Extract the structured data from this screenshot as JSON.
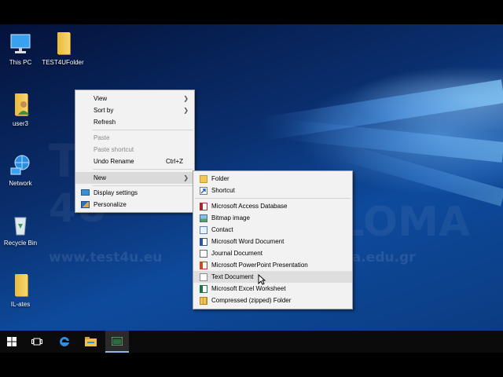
{
  "desktop_icons": [
    {
      "label": "This PC",
      "icon": "computer-icon"
    },
    {
      "label": "TEST4UFolder",
      "icon": "folder-icon"
    },
    {
      "label": "user3",
      "icon": "user-folder-icon"
    },
    {
      "label": "Network",
      "icon": "network-icon"
    },
    {
      "label": "Recycle Bin",
      "icon": "recycle-bin-icon"
    },
    {
      "label": "IL-ates",
      "icon": "folder-icon"
    }
  ],
  "watermark": {
    "brand_left": "TEST",
    "brand_left2": "4U",
    "brand_right": "DIPLOMA",
    "url_left": "www.test4u.eu",
    "url_right": "www.diploma.edu.gr"
  },
  "context_menu": {
    "items": [
      {
        "label": "View",
        "submenu": true
      },
      {
        "label": "Sort by",
        "submenu": true
      },
      {
        "label": "Refresh"
      },
      {
        "label": "Paste",
        "disabled": true
      },
      {
        "label": "Paste shortcut",
        "disabled": true
      },
      {
        "label": "Undo Rename",
        "shortcut": "Ctrl+Z"
      },
      {
        "label": "New",
        "submenu": true,
        "highlighted": true
      },
      {
        "label": "Display settings",
        "icon": "display-icon"
      },
      {
        "label": "Personalize",
        "icon": "personalize-icon"
      }
    ]
  },
  "new_submenu": {
    "items": [
      {
        "label": "Folder",
        "icon": "folder-icon"
      },
      {
        "label": "Shortcut",
        "icon": "shortcut-icon"
      },
      {
        "label": "Microsoft Access Database",
        "icon": "access-icon"
      },
      {
        "label": "Bitmap image",
        "icon": "bitmap-icon"
      },
      {
        "label": "Contact",
        "icon": "contact-icon"
      },
      {
        "label": "Microsoft Word Document",
        "icon": "word-icon"
      },
      {
        "label": "Journal Document",
        "icon": "journal-icon"
      },
      {
        "label": "Microsoft PowerPoint Presentation",
        "icon": "powerpoint-icon"
      },
      {
        "label": "Text Document",
        "icon": "text-document-icon",
        "highlighted": true
      },
      {
        "label": "Microsoft Excel Worksheet",
        "icon": "excel-icon"
      },
      {
        "label": "Compressed (zipped) Folder",
        "icon": "zip-folder-icon"
      }
    ]
  },
  "taskbar": {
    "buttons": [
      {
        "icon": "windows-start-icon"
      },
      {
        "icon": "task-view-icon"
      },
      {
        "icon": "edge-icon"
      },
      {
        "icon": "file-explorer-icon"
      },
      {
        "icon": "app-window-icon",
        "active": true
      }
    ]
  },
  "colors": {
    "accent": "#0e4a9c",
    "menu_bg": "#f2f2f2",
    "highlight": "#dadada"
  }
}
